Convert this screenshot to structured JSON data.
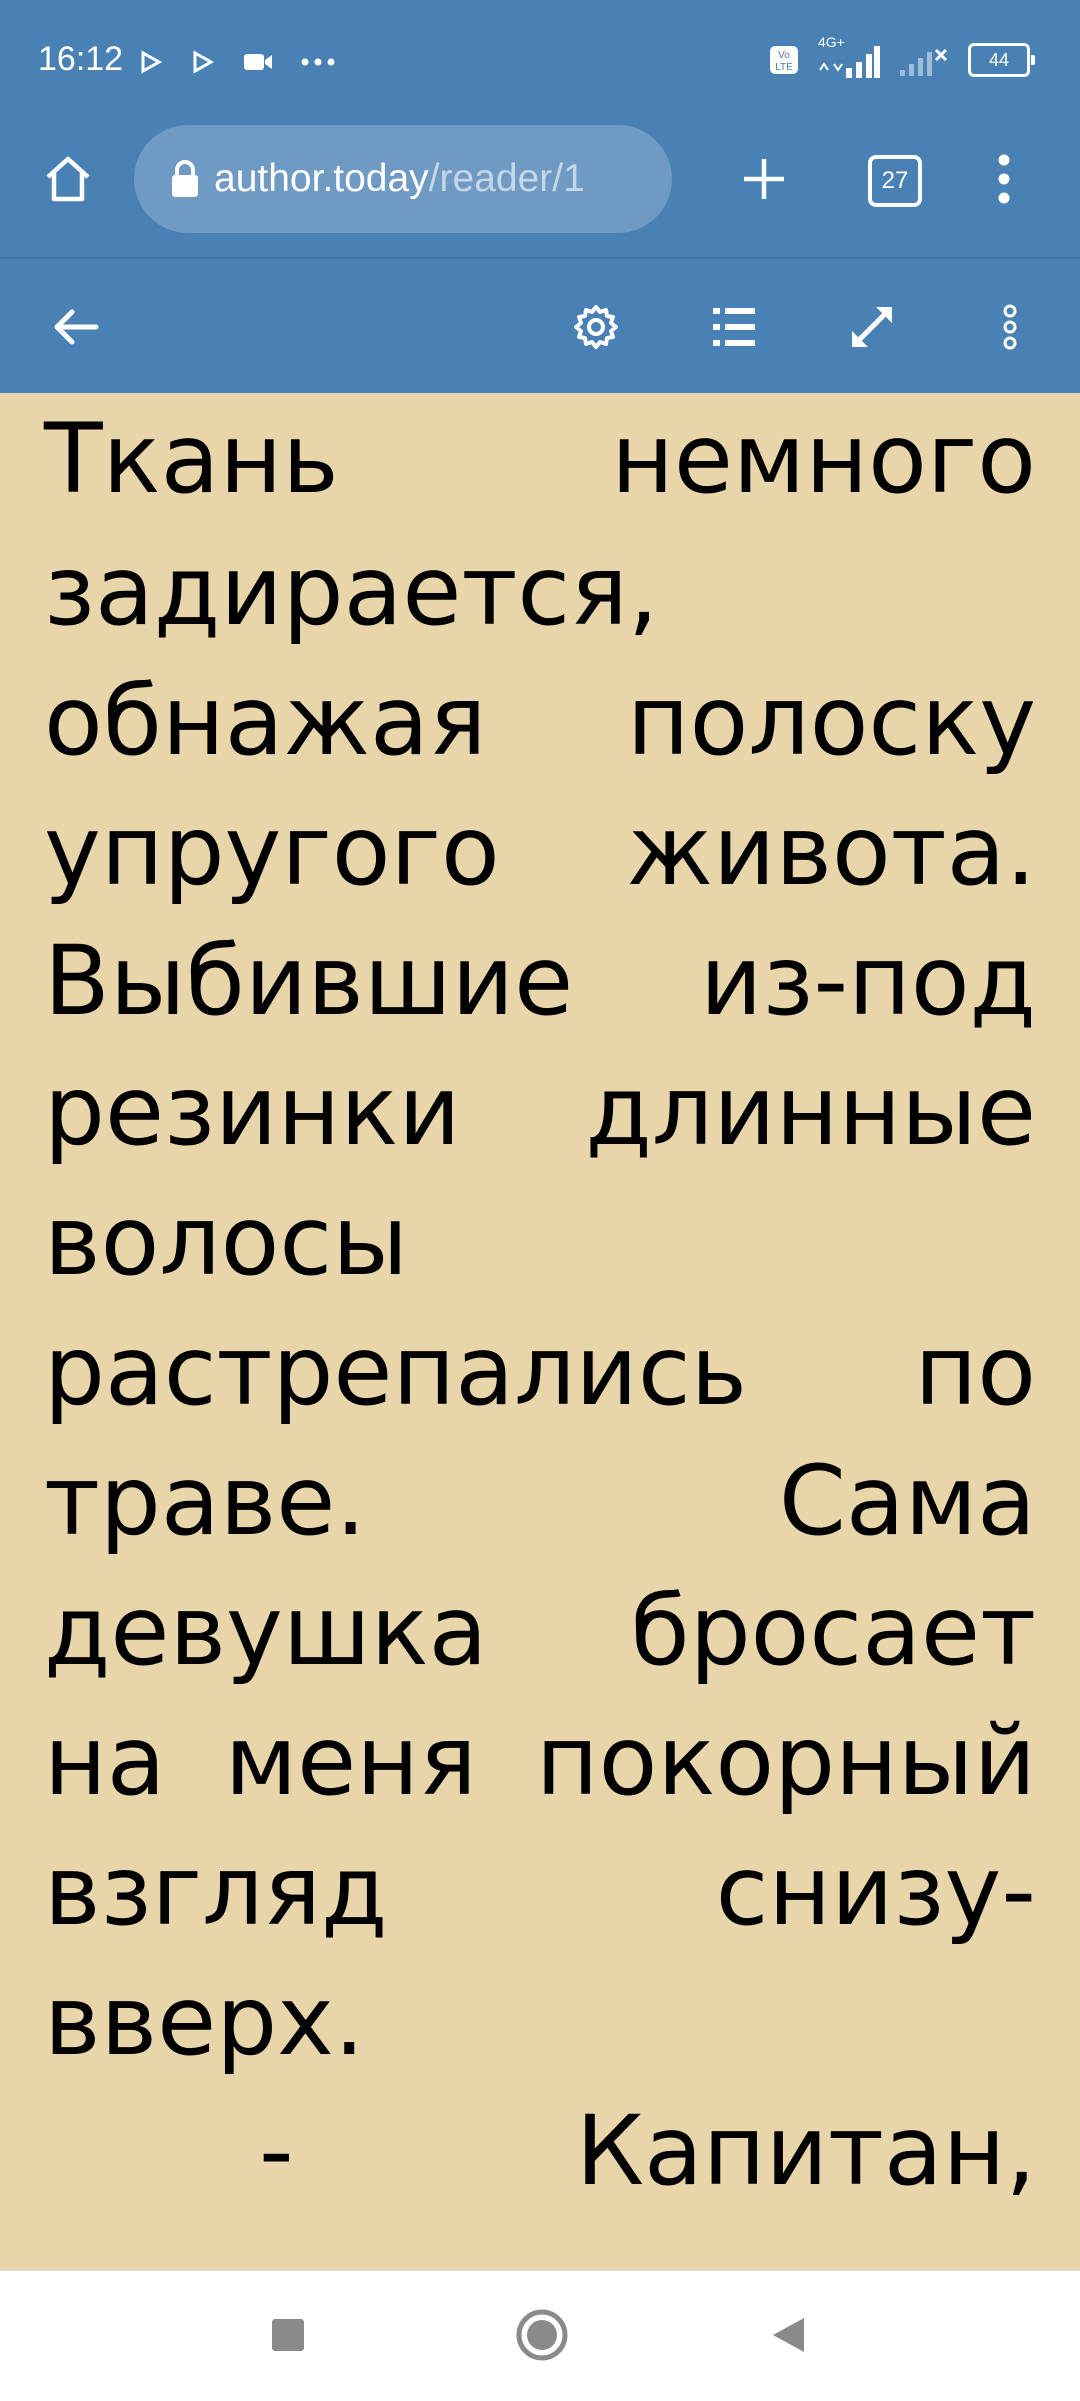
{
  "status": {
    "time": "16:12",
    "network": "4G+",
    "volte": "Vo LTE",
    "battery": "44"
  },
  "browser": {
    "url_host": "author.today",
    "url_path": "/reader/1",
    "tab_count": "27"
  },
  "reader": {
    "lines": [
      [
        "Ткань",
        "немного"
      ],
      [
        "задирается,"
      ],
      [
        "обнажая",
        "полоску"
      ],
      [
        "упругого",
        "живота."
      ],
      [
        "Выбившие",
        "из-под"
      ],
      [
        "резинки",
        "длинные"
      ],
      [
        "волосы"
      ],
      [
        "растрепались",
        "по"
      ],
      [
        "траве.",
        "Сама"
      ],
      [
        "девушка",
        "бросает"
      ],
      [
        "на",
        "меня",
        "покорный"
      ],
      [
        "взгляд",
        "снизу-"
      ],
      [
        "вверх."
      ],
      [
        "-",
        "Капитан,"
      ]
    ]
  },
  "colors": {
    "bar_blue": "#4a81b4",
    "page_bg": "#e8d5a9",
    "url_pill": "#6f9ac3"
  },
  "icons": {
    "home": "home-icon",
    "lock": "lock-icon",
    "new_tab": "plus-icon",
    "menu": "more-vert-icon",
    "back": "arrow-left-icon",
    "settings": "gear-icon",
    "contents": "list-icon",
    "fullscreen": "expand-icon",
    "nav_recents": "square-icon",
    "nav_home": "circle-icon",
    "nav_back": "triangle-back-icon"
  }
}
